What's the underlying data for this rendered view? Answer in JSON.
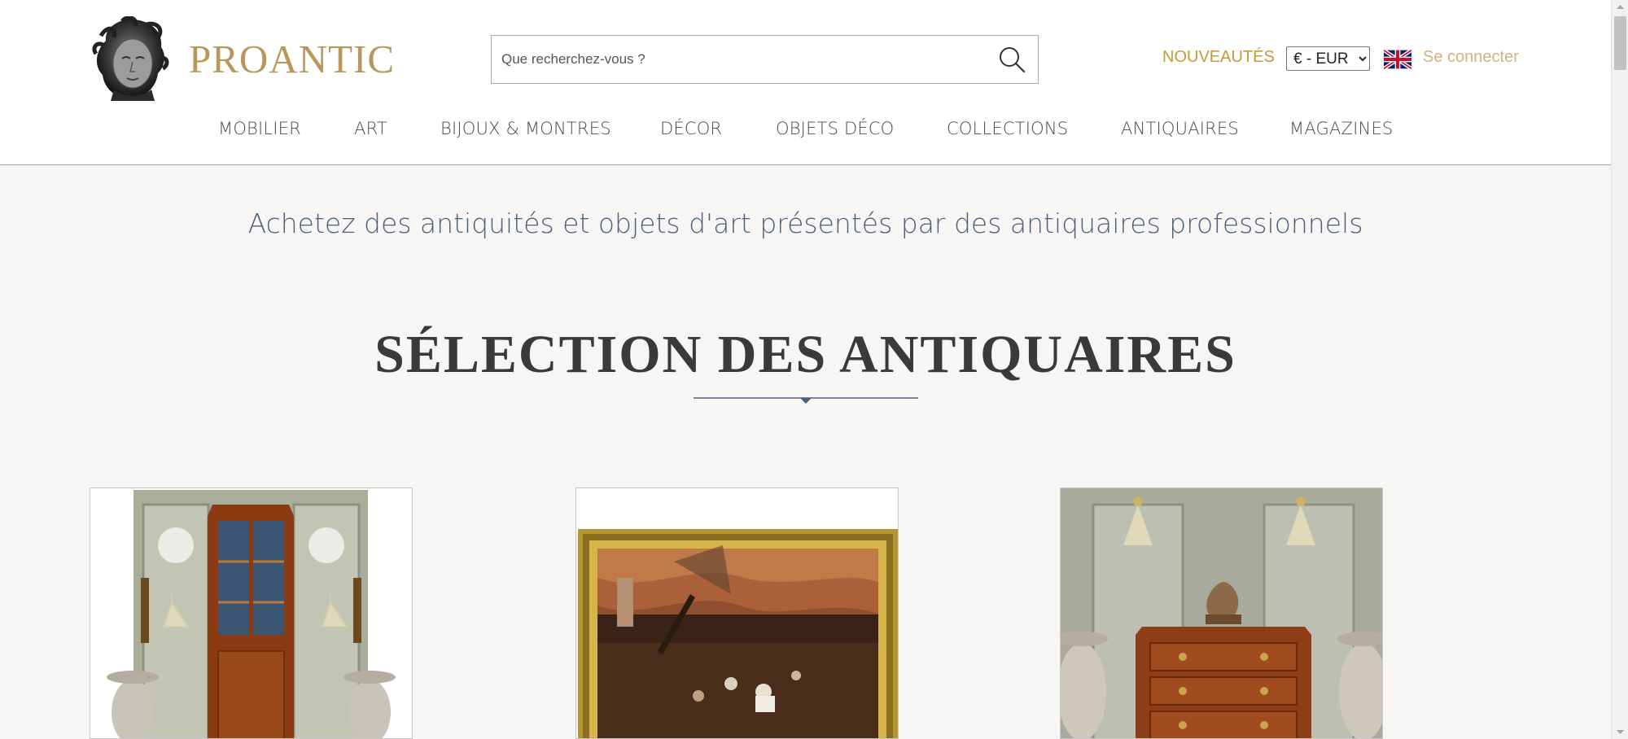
{
  "header": {
    "brand": "PROANTIC",
    "search_placeholder": "Que recherchez-vous ?",
    "nouveautes": "NOUVEAUTÉS",
    "currency_selected": "€ - EUR",
    "language_flag": "uk-flag-icon",
    "login": "Se connecter"
  },
  "nav": [
    {
      "label": "MOBILIER"
    },
    {
      "label": "ART"
    },
    {
      "label": "BIJOUX & MONTRES"
    },
    {
      "label": "DÉCOR"
    },
    {
      "label": "OBJETS DÉCO"
    },
    {
      "label": "COLLECTIONS"
    },
    {
      "label": "ANTIQUAIRES"
    },
    {
      "label": "MAGAZINES"
    }
  ],
  "main": {
    "tagline": "Achetez des antiquités et objets d'art présentés par des antiquaires professionnels",
    "section_title": "SÉLECTION DES ANTIQUAIRES"
  },
  "colors": {
    "brand_gold": "#b7975a",
    "nouveautes_gold": "#c59a3a",
    "login_gold": "#d2b27f",
    "tagline_blue": "#4d6079",
    "background": "#f7f6f5"
  },
  "icons": [
    "search-icon",
    "uk-flag-icon",
    "logo-bust-icon",
    "chevron-divider-icon"
  ]
}
